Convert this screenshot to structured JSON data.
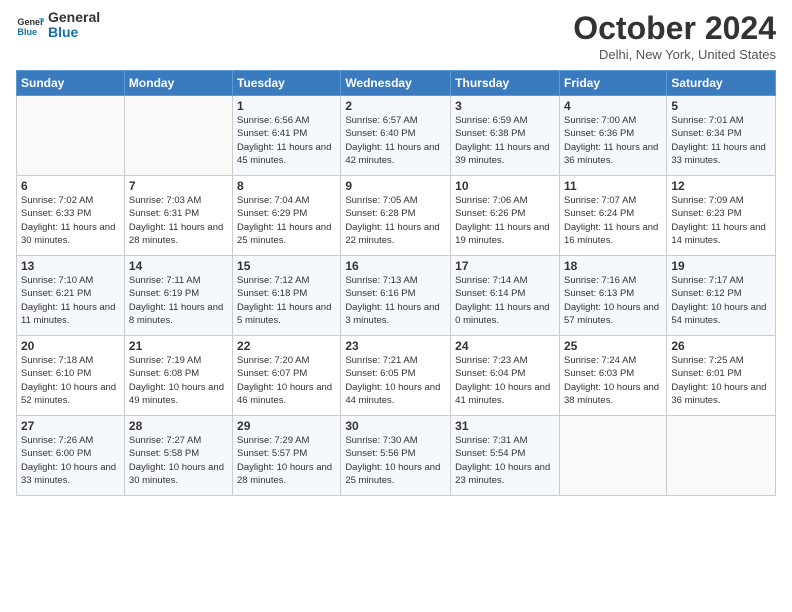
{
  "header": {
    "logo_line1": "General",
    "logo_line2": "Blue",
    "month": "October 2024",
    "location": "Delhi, New York, United States"
  },
  "weekdays": [
    "Sunday",
    "Monday",
    "Tuesday",
    "Wednesday",
    "Thursday",
    "Friday",
    "Saturday"
  ],
  "weeks": [
    [
      {
        "day": "",
        "info": ""
      },
      {
        "day": "",
        "info": ""
      },
      {
        "day": "1",
        "info": "Sunrise: 6:56 AM\nSunset: 6:41 PM\nDaylight: 11 hours and 45 minutes."
      },
      {
        "day": "2",
        "info": "Sunrise: 6:57 AM\nSunset: 6:40 PM\nDaylight: 11 hours and 42 minutes."
      },
      {
        "day": "3",
        "info": "Sunrise: 6:59 AM\nSunset: 6:38 PM\nDaylight: 11 hours and 39 minutes."
      },
      {
        "day": "4",
        "info": "Sunrise: 7:00 AM\nSunset: 6:36 PM\nDaylight: 11 hours and 36 minutes."
      },
      {
        "day": "5",
        "info": "Sunrise: 7:01 AM\nSunset: 6:34 PM\nDaylight: 11 hours and 33 minutes."
      }
    ],
    [
      {
        "day": "6",
        "info": "Sunrise: 7:02 AM\nSunset: 6:33 PM\nDaylight: 11 hours and 30 minutes."
      },
      {
        "day": "7",
        "info": "Sunrise: 7:03 AM\nSunset: 6:31 PM\nDaylight: 11 hours and 28 minutes."
      },
      {
        "day": "8",
        "info": "Sunrise: 7:04 AM\nSunset: 6:29 PM\nDaylight: 11 hours and 25 minutes."
      },
      {
        "day": "9",
        "info": "Sunrise: 7:05 AM\nSunset: 6:28 PM\nDaylight: 11 hours and 22 minutes."
      },
      {
        "day": "10",
        "info": "Sunrise: 7:06 AM\nSunset: 6:26 PM\nDaylight: 11 hours and 19 minutes."
      },
      {
        "day": "11",
        "info": "Sunrise: 7:07 AM\nSunset: 6:24 PM\nDaylight: 11 hours and 16 minutes."
      },
      {
        "day": "12",
        "info": "Sunrise: 7:09 AM\nSunset: 6:23 PM\nDaylight: 11 hours and 14 minutes."
      }
    ],
    [
      {
        "day": "13",
        "info": "Sunrise: 7:10 AM\nSunset: 6:21 PM\nDaylight: 11 hours and 11 minutes."
      },
      {
        "day": "14",
        "info": "Sunrise: 7:11 AM\nSunset: 6:19 PM\nDaylight: 11 hours and 8 minutes."
      },
      {
        "day": "15",
        "info": "Sunrise: 7:12 AM\nSunset: 6:18 PM\nDaylight: 11 hours and 5 minutes."
      },
      {
        "day": "16",
        "info": "Sunrise: 7:13 AM\nSunset: 6:16 PM\nDaylight: 11 hours and 3 minutes."
      },
      {
        "day": "17",
        "info": "Sunrise: 7:14 AM\nSunset: 6:14 PM\nDaylight: 11 hours and 0 minutes."
      },
      {
        "day": "18",
        "info": "Sunrise: 7:16 AM\nSunset: 6:13 PM\nDaylight: 10 hours and 57 minutes."
      },
      {
        "day": "19",
        "info": "Sunrise: 7:17 AM\nSunset: 6:12 PM\nDaylight: 10 hours and 54 minutes."
      }
    ],
    [
      {
        "day": "20",
        "info": "Sunrise: 7:18 AM\nSunset: 6:10 PM\nDaylight: 10 hours and 52 minutes."
      },
      {
        "day": "21",
        "info": "Sunrise: 7:19 AM\nSunset: 6:08 PM\nDaylight: 10 hours and 49 minutes."
      },
      {
        "day": "22",
        "info": "Sunrise: 7:20 AM\nSunset: 6:07 PM\nDaylight: 10 hours and 46 minutes."
      },
      {
        "day": "23",
        "info": "Sunrise: 7:21 AM\nSunset: 6:05 PM\nDaylight: 10 hours and 44 minutes."
      },
      {
        "day": "24",
        "info": "Sunrise: 7:23 AM\nSunset: 6:04 PM\nDaylight: 10 hours and 41 minutes."
      },
      {
        "day": "25",
        "info": "Sunrise: 7:24 AM\nSunset: 6:03 PM\nDaylight: 10 hours and 38 minutes."
      },
      {
        "day": "26",
        "info": "Sunrise: 7:25 AM\nSunset: 6:01 PM\nDaylight: 10 hours and 36 minutes."
      }
    ],
    [
      {
        "day": "27",
        "info": "Sunrise: 7:26 AM\nSunset: 6:00 PM\nDaylight: 10 hours and 33 minutes."
      },
      {
        "day": "28",
        "info": "Sunrise: 7:27 AM\nSunset: 5:58 PM\nDaylight: 10 hours and 30 minutes."
      },
      {
        "day": "29",
        "info": "Sunrise: 7:29 AM\nSunset: 5:57 PM\nDaylight: 10 hours and 28 minutes."
      },
      {
        "day": "30",
        "info": "Sunrise: 7:30 AM\nSunset: 5:56 PM\nDaylight: 10 hours and 25 minutes."
      },
      {
        "day": "31",
        "info": "Sunrise: 7:31 AM\nSunset: 5:54 PM\nDaylight: 10 hours and 23 minutes."
      },
      {
        "day": "",
        "info": ""
      },
      {
        "day": "",
        "info": ""
      }
    ]
  ]
}
